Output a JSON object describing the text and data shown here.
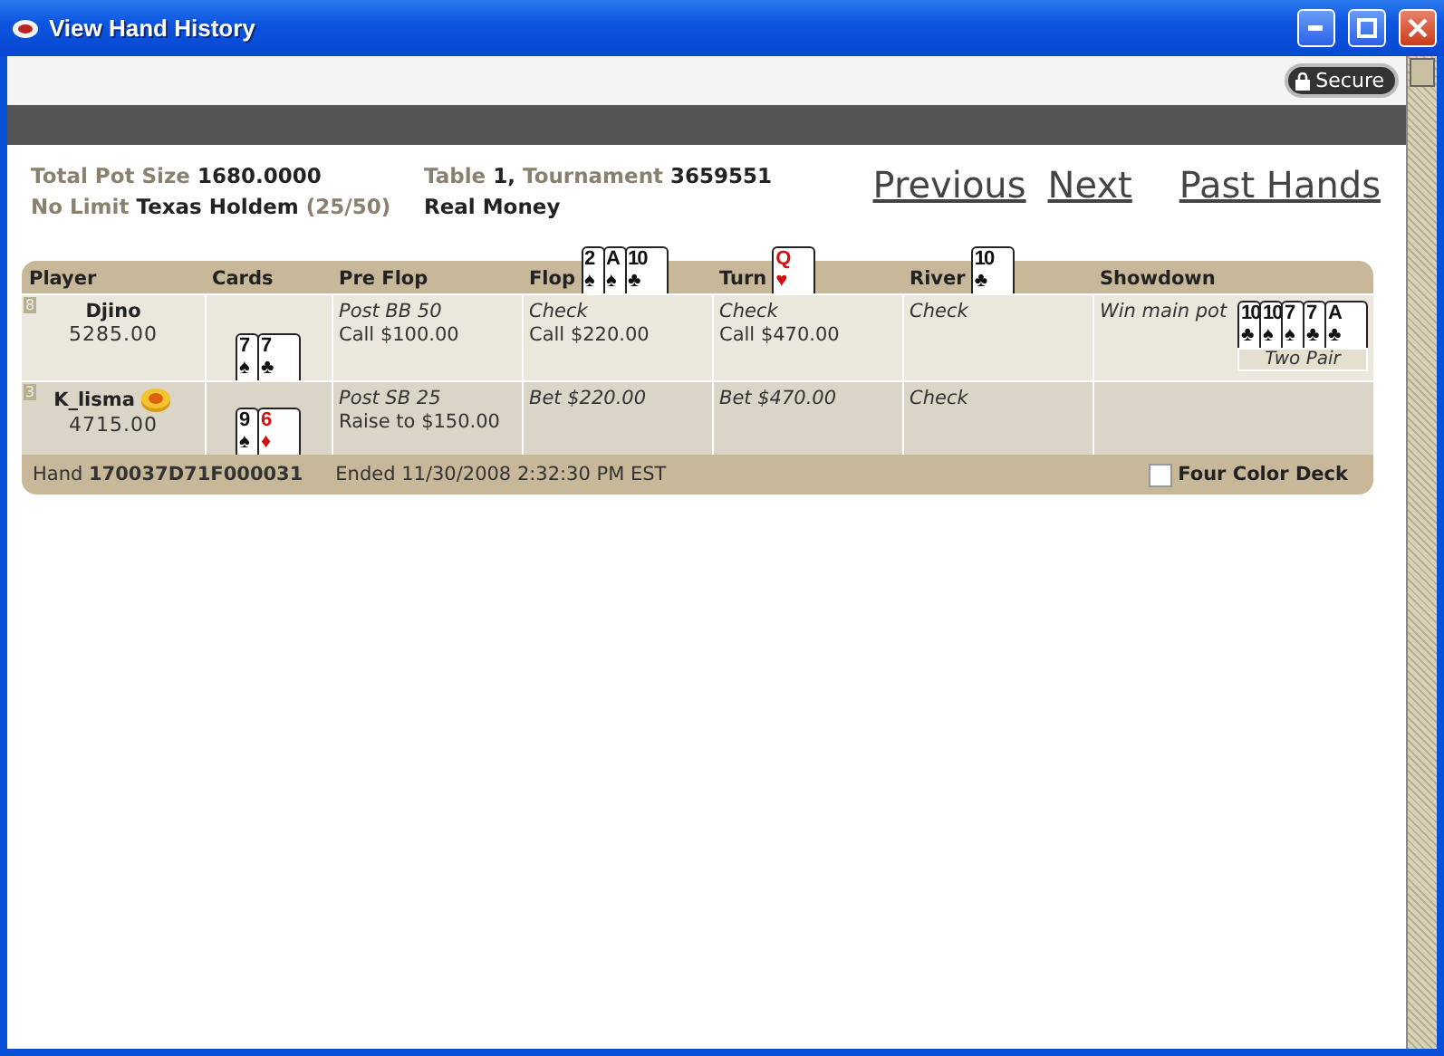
{
  "window": {
    "title": "View Hand History"
  },
  "secure": {
    "label": "Secure"
  },
  "info": {
    "pot_label": "Total Pot Size",
    "pot": "1680.0000",
    "limit_label": "No Limit",
    "game": "Texas Holdem",
    "blinds": "(25/50)",
    "table_label": "Table",
    "table": "1,",
    "tournament_label": "Tournament",
    "tournament": "3659551",
    "money": "Real Money"
  },
  "nav": [
    "Previous",
    "Next",
    "Past Hands"
  ],
  "columns": [
    {
      "label": "Player"
    },
    {
      "label": "Cards"
    },
    {
      "label": "Pre Flop"
    },
    {
      "label": "Flop",
      "cards": [
        {
          "rank": "2",
          "suit": "♠",
          "red": false
        },
        {
          "rank": "A",
          "suit": "♠",
          "red": false
        },
        {
          "rank": "10",
          "suit": "♣",
          "red": false
        }
      ]
    },
    {
      "label": "Turn",
      "cards": [
        {
          "rank": "Q",
          "suit": "♥",
          "red": true
        }
      ]
    },
    {
      "label": "River",
      "cards": [
        {
          "rank": "10",
          "suit": "♣",
          "red": false
        }
      ]
    },
    {
      "label": "Showdown"
    }
  ],
  "rows": [
    {
      "seat": "8",
      "name": "Djino",
      "dealer": false,
      "stack": "5285.00",
      "cards": [
        {
          "rank": "7",
          "suit": "♠",
          "red": false
        },
        {
          "rank": "7",
          "suit": "♣",
          "red": false
        }
      ],
      "actions": [
        [
          "Post BB 50",
          "Call $100.00"
        ],
        [
          "Check",
          "Call $220.00"
        ],
        [
          "Check",
          "Call $470.00"
        ],
        [
          "Check"
        ]
      ],
      "showdown": {
        "result": "Win main pot",
        "hand": "Two Pair",
        "cards": [
          {
            "rank": "10",
            "suit": "♣",
            "red": false
          },
          {
            "rank": "10",
            "suit": "♠",
            "red": false
          },
          {
            "rank": "7",
            "suit": "♠",
            "red": false
          },
          {
            "rank": "7",
            "suit": "♣",
            "red": false
          },
          {
            "rank": "A",
            "suit": "♣",
            "red": false
          }
        ]
      }
    },
    {
      "seat": "3",
      "name": "K_lisma",
      "dealer": true,
      "stack": "4715.00",
      "cards": [
        {
          "rank": "9",
          "suit": "♠",
          "red": false
        },
        {
          "rank": "6",
          "suit": "♦",
          "red": true
        }
      ],
      "actions": [
        [
          "Post SB 25",
          "Raise to $150.00"
        ],
        [
          "Bet $220.00"
        ],
        [
          "Bet $470.00"
        ],
        [
          "Check"
        ]
      ]
    }
  ],
  "footer": {
    "hand_label": "Hand",
    "hand": "170037D71F000031",
    "ended": "Ended 11/30/2008 2:32:30 PM EST",
    "four_color_label": "Four Color Deck",
    "four_color_checked": false
  }
}
